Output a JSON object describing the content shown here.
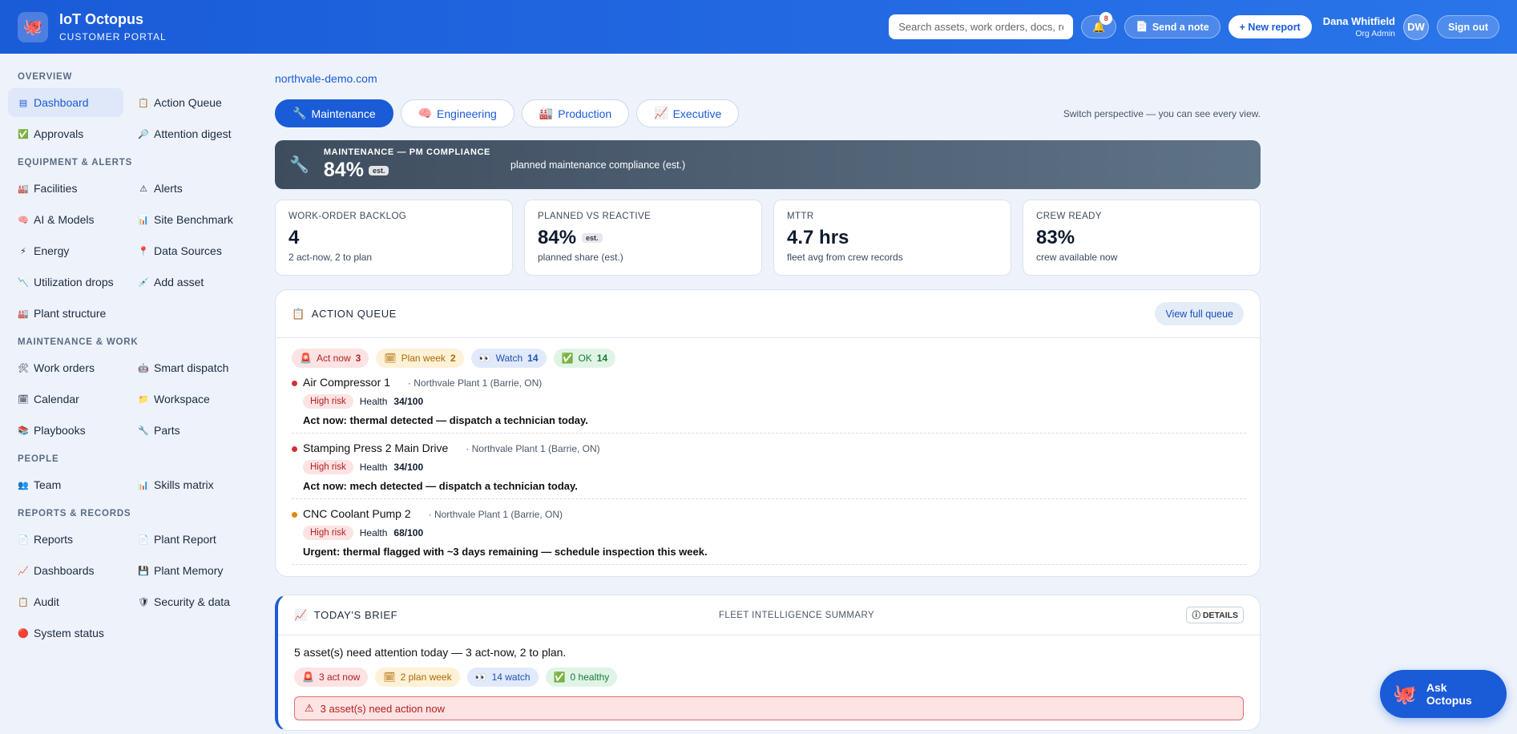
{
  "header": {
    "brand_title": "IoT Octopus",
    "brand_sub": "CUSTOMER PORTAL",
    "search_placeholder": "Search assets, work orders, docs, reports",
    "notification_count": "8",
    "send_note": "Send a note",
    "new_report": "+ New report",
    "user_name": "Dana Whitfield",
    "user_role": "Org Admin",
    "avatar_initials": "DW",
    "sign_out": "Sign out"
  },
  "sidebar": {
    "sections": [
      {
        "title": "OVERVIEW",
        "items": [
          {
            "label": "Dashboard",
            "icon": "▤",
            "active": true
          },
          {
            "label": "Action Queue",
            "icon": "📋"
          },
          {
            "label": "Approvals",
            "icon": "✅"
          },
          {
            "label": "Attention digest",
            "icon": "🔎"
          }
        ]
      },
      {
        "title": "EQUIPMENT & ALERTS",
        "items": [
          {
            "label": "Facilities",
            "icon": "🏭"
          },
          {
            "label": "Alerts",
            "icon": "⚠"
          },
          {
            "label": "AI & Models",
            "icon": "🧠"
          },
          {
            "label": "Site Benchmark",
            "icon": "📊"
          },
          {
            "label": "Energy",
            "icon": "⚡"
          },
          {
            "label": "Data Sources",
            "icon": "📍"
          },
          {
            "label": "Utilization drops",
            "icon": "📉"
          },
          {
            "label": "Add asset",
            "icon": "💉"
          },
          {
            "label": "Plant structure",
            "icon": "🏭"
          }
        ]
      },
      {
        "title": "MAINTENANCE & WORK",
        "items": [
          {
            "label": "Work orders",
            "icon": "🛠"
          },
          {
            "label": "Smart dispatch",
            "icon": "🤖"
          },
          {
            "label": "Calendar",
            "icon": "🗓"
          },
          {
            "label": "Workspace",
            "icon": "📁"
          },
          {
            "label": "Playbooks",
            "icon": "📚"
          },
          {
            "label": "Parts",
            "icon": "🔧"
          }
        ]
      },
      {
        "title": "PEOPLE",
        "items": [
          {
            "label": "Team",
            "icon": "👥"
          },
          {
            "label": "Skills matrix",
            "icon": "📊"
          }
        ]
      },
      {
        "title": "REPORTS & RECORDS",
        "items": [
          {
            "label": "Reports",
            "icon": "📄"
          },
          {
            "label": "Plant Report",
            "icon": "📄"
          },
          {
            "label": "Dashboards",
            "icon": "📈"
          },
          {
            "label": "Plant Memory",
            "icon": "💾"
          },
          {
            "label": "Audit",
            "icon": "📋"
          },
          {
            "label": "Security & data",
            "icon": "🛡"
          },
          {
            "label": "System status",
            "icon": "🔴"
          }
        ]
      }
    ]
  },
  "main": {
    "domain": "northvale-demo.com",
    "tabs": [
      {
        "label": "Maintenance",
        "icon": "🔧",
        "active": true
      },
      {
        "label": "Engineering",
        "icon": "🧠"
      },
      {
        "label": "Production",
        "icon": "🏭"
      },
      {
        "label": "Executive",
        "icon": "📈"
      }
    ],
    "perspective_note": "Switch perspective — you can see every view.",
    "hero": {
      "label": "MAINTENANCE — PM COMPLIANCE",
      "value": "84%",
      "est": "est.",
      "desc": "planned maintenance compliance (est.)"
    },
    "kpis": [
      {
        "label": "WORK-ORDER BACKLOG",
        "value": "4",
        "sub": "2 act-now, 2 to plan"
      },
      {
        "label": "PLANNED VS REACTIVE",
        "value": "84%",
        "est": "est.",
        "sub": "planned share (est.)"
      },
      {
        "label": "MTTR",
        "value": "4.7 hrs",
        "sub": "fleet avg from crew records"
      },
      {
        "label": "CREW READY",
        "value": "83%",
        "sub": "crew available now"
      }
    ],
    "action_queue": {
      "title": "ACTION QUEUE",
      "view_full": "View full queue",
      "chips": [
        {
          "label": "Act now",
          "count": "3",
          "icon": "🚨",
          "tone": "red"
        },
        {
          "label": "Plan week",
          "count": "2",
          "icon": "🗓",
          "tone": "yel"
        },
        {
          "label": "Watch",
          "count": "14",
          "icon": "👀",
          "tone": "blu"
        },
        {
          "label": "OK",
          "count": "14",
          "icon": "✅",
          "tone": "grn"
        }
      ],
      "items": [
        {
          "name": "Air Compressor 1",
          "location": "· Northvale Plant 1 (Barrie, ON)",
          "risk": "High risk",
          "health_label": "Health",
          "health": "34/100",
          "action": "Act now: thermal detected — dispatch a technician today.",
          "dot": "#d32f2f"
        },
        {
          "name": "Stamping Press 2 Main Drive",
          "location": "· Northvale Plant 1 (Barrie, ON)",
          "risk": "High risk",
          "health_label": "Health",
          "health": "34/100",
          "action": "Act now: mech detected — dispatch a technician today.",
          "dot": "#d32f2f"
        },
        {
          "name": "CNC Coolant Pump 2",
          "location": "· Northvale Plant 1 (Barrie, ON)",
          "risk": "High risk",
          "health_label": "Health",
          "health": "68/100",
          "action": "Urgent: thermal flagged with ~3 days remaining — schedule inspection this week.",
          "dot": "#e08a00"
        }
      ]
    },
    "brief": {
      "title": "TODAY'S BRIEF",
      "subtitle": "FLEET INTELLIGENCE SUMMARY",
      "details": "ⓘ DETAILS",
      "summary": "5 asset(s) need attention today — 3 act-now, 2 to plan.",
      "chips": [
        {
          "label": "3 act now",
          "icon": "🚨",
          "tone": "red"
        },
        {
          "label": "2 plan week",
          "icon": "🗓",
          "tone": "yel"
        },
        {
          "label": "14 watch",
          "icon": "👀",
          "tone": "blu"
        },
        {
          "label": "0 healthy",
          "icon": "✅",
          "tone": "grn"
        }
      ],
      "alert": "3 asset(s) need action now"
    }
  },
  "assistant": {
    "label": "Ask Octopus"
  }
}
